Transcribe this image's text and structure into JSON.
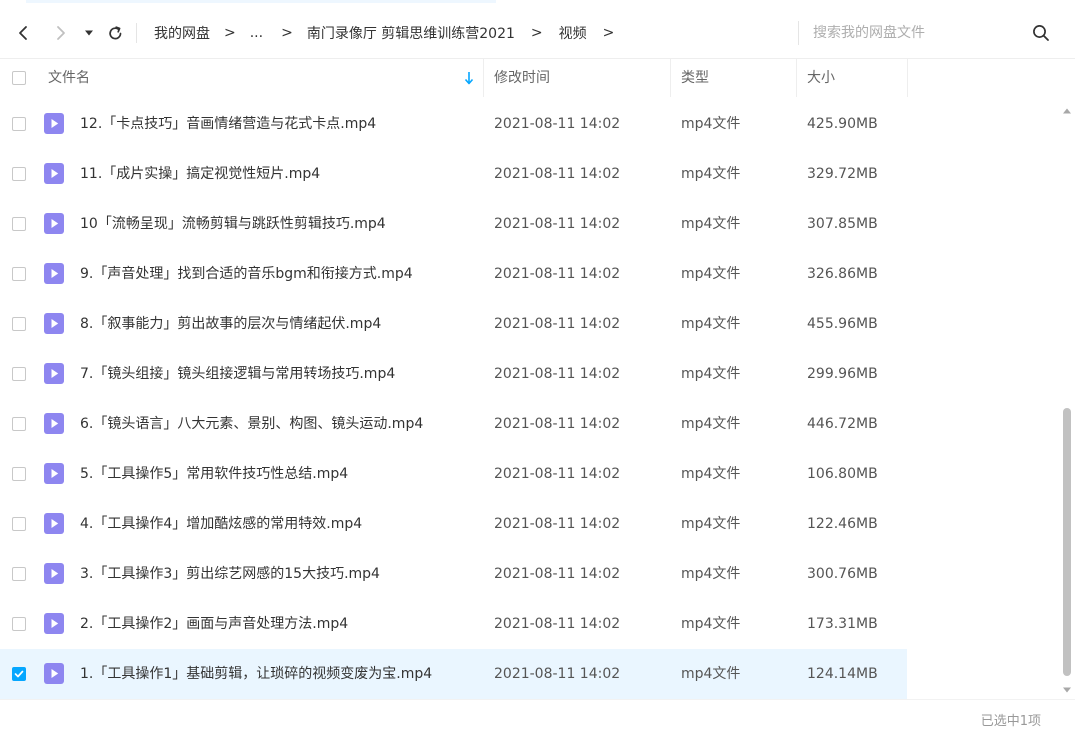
{
  "nav": {
    "breadcrumbs": [
      "我的网盘",
      "...",
      "南门录像厅 剪辑思维训练营2021",
      "视频"
    ],
    "separator": ">"
  },
  "search": {
    "placeholder": "搜索我的网盘文件"
  },
  "table": {
    "columns": {
      "name": "文件名",
      "modified": "修改时间",
      "type": "类型",
      "size": "大小"
    },
    "sort_indicator": "arrow-down-icon",
    "rows": [
      {
        "name": "12.「卡点技巧」音画情绪营造与花式卡点.mp4",
        "modified": "2021-08-11 14:02",
        "type": "mp4文件",
        "size": "425.90MB",
        "checked": false
      },
      {
        "name": "11.「成片实操」搞定视觉性短片.mp4",
        "modified": "2021-08-11 14:02",
        "type": "mp4文件",
        "size": "329.72MB",
        "checked": false
      },
      {
        "name": "10「流畅呈现」流畅剪辑与跳跃性剪辑技巧.mp4",
        "modified": "2021-08-11 14:02",
        "type": "mp4文件",
        "size": "307.85MB",
        "checked": false
      },
      {
        "name": "9.「声音处理」找到合适的音乐bgm和衔接方式.mp4",
        "modified": "2021-08-11 14:02",
        "type": "mp4文件",
        "size": "326.86MB",
        "checked": false
      },
      {
        "name": "8.「叙事能力」剪出故事的层次与情绪起伏.mp4",
        "modified": "2021-08-11 14:02",
        "type": "mp4文件",
        "size": "455.96MB",
        "checked": false
      },
      {
        "name": "7.「镜头组接」镜头组接逻辑与常用转场技巧.mp4",
        "modified": "2021-08-11 14:02",
        "type": "mp4文件",
        "size": "299.96MB",
        "checked": false
      },
      {
        "name": "6.「镜头语言」八大元素、景别、构图、镜头运动.mp4",
        "modified": "2021-08-11 14:02",
        "type": "mp4文件",
        "size": "446.72MB",
        "checked": false
      },
      {
        "name": "5.「工具操作5」常用软件技巧性总结.mp4",
        "modified": "2021-08-11 14:02",
        "type": "mp4文件",
        "size": "106.80MB",
        "checked": false
      },
      {
        "name": "4.「工具操作4」增加酷炫感的常用特效.mp4",
        "modified": "2021-08-11 14:02",
        "type": "mp4文件",
        "size": "122.46MB",
        "checked": false
      },
      {
        "name": "3.「工具操作3」剪出综艺网感的15大技巧.mp4",
        "modified": "2021-08-11 14:02",
        "type": "mp4文件",
        "size": "300.76MB",
        "checked": false
      },
      {
        "name": "2.「工具操作2」画面与声音处理方法.mp4",
        "modified": "2021-08-11 14:02",
        "type": "mp4文件",
        "size": "173.31MB",
        "checked": false
      },
      {
        "name": "1.「工具操作1」基础剪辑，让琐碎的视频变废为宝.mp4",
        "modified": "2021-08-11 14:02",
        "type": "mp4文件",
        "size": "124.14MB",
        "checked": true
      }
    ]
  },
  "status": {
    "selected_text": "已选中1项"
  },
  "colors": {
    "accent": "#06a7ff",
    "video_icon": "#8e86f0",
    "selected_row": "#eaf6ff",
    "text": "#333333",
    "muted": "#999999"
  }
}
